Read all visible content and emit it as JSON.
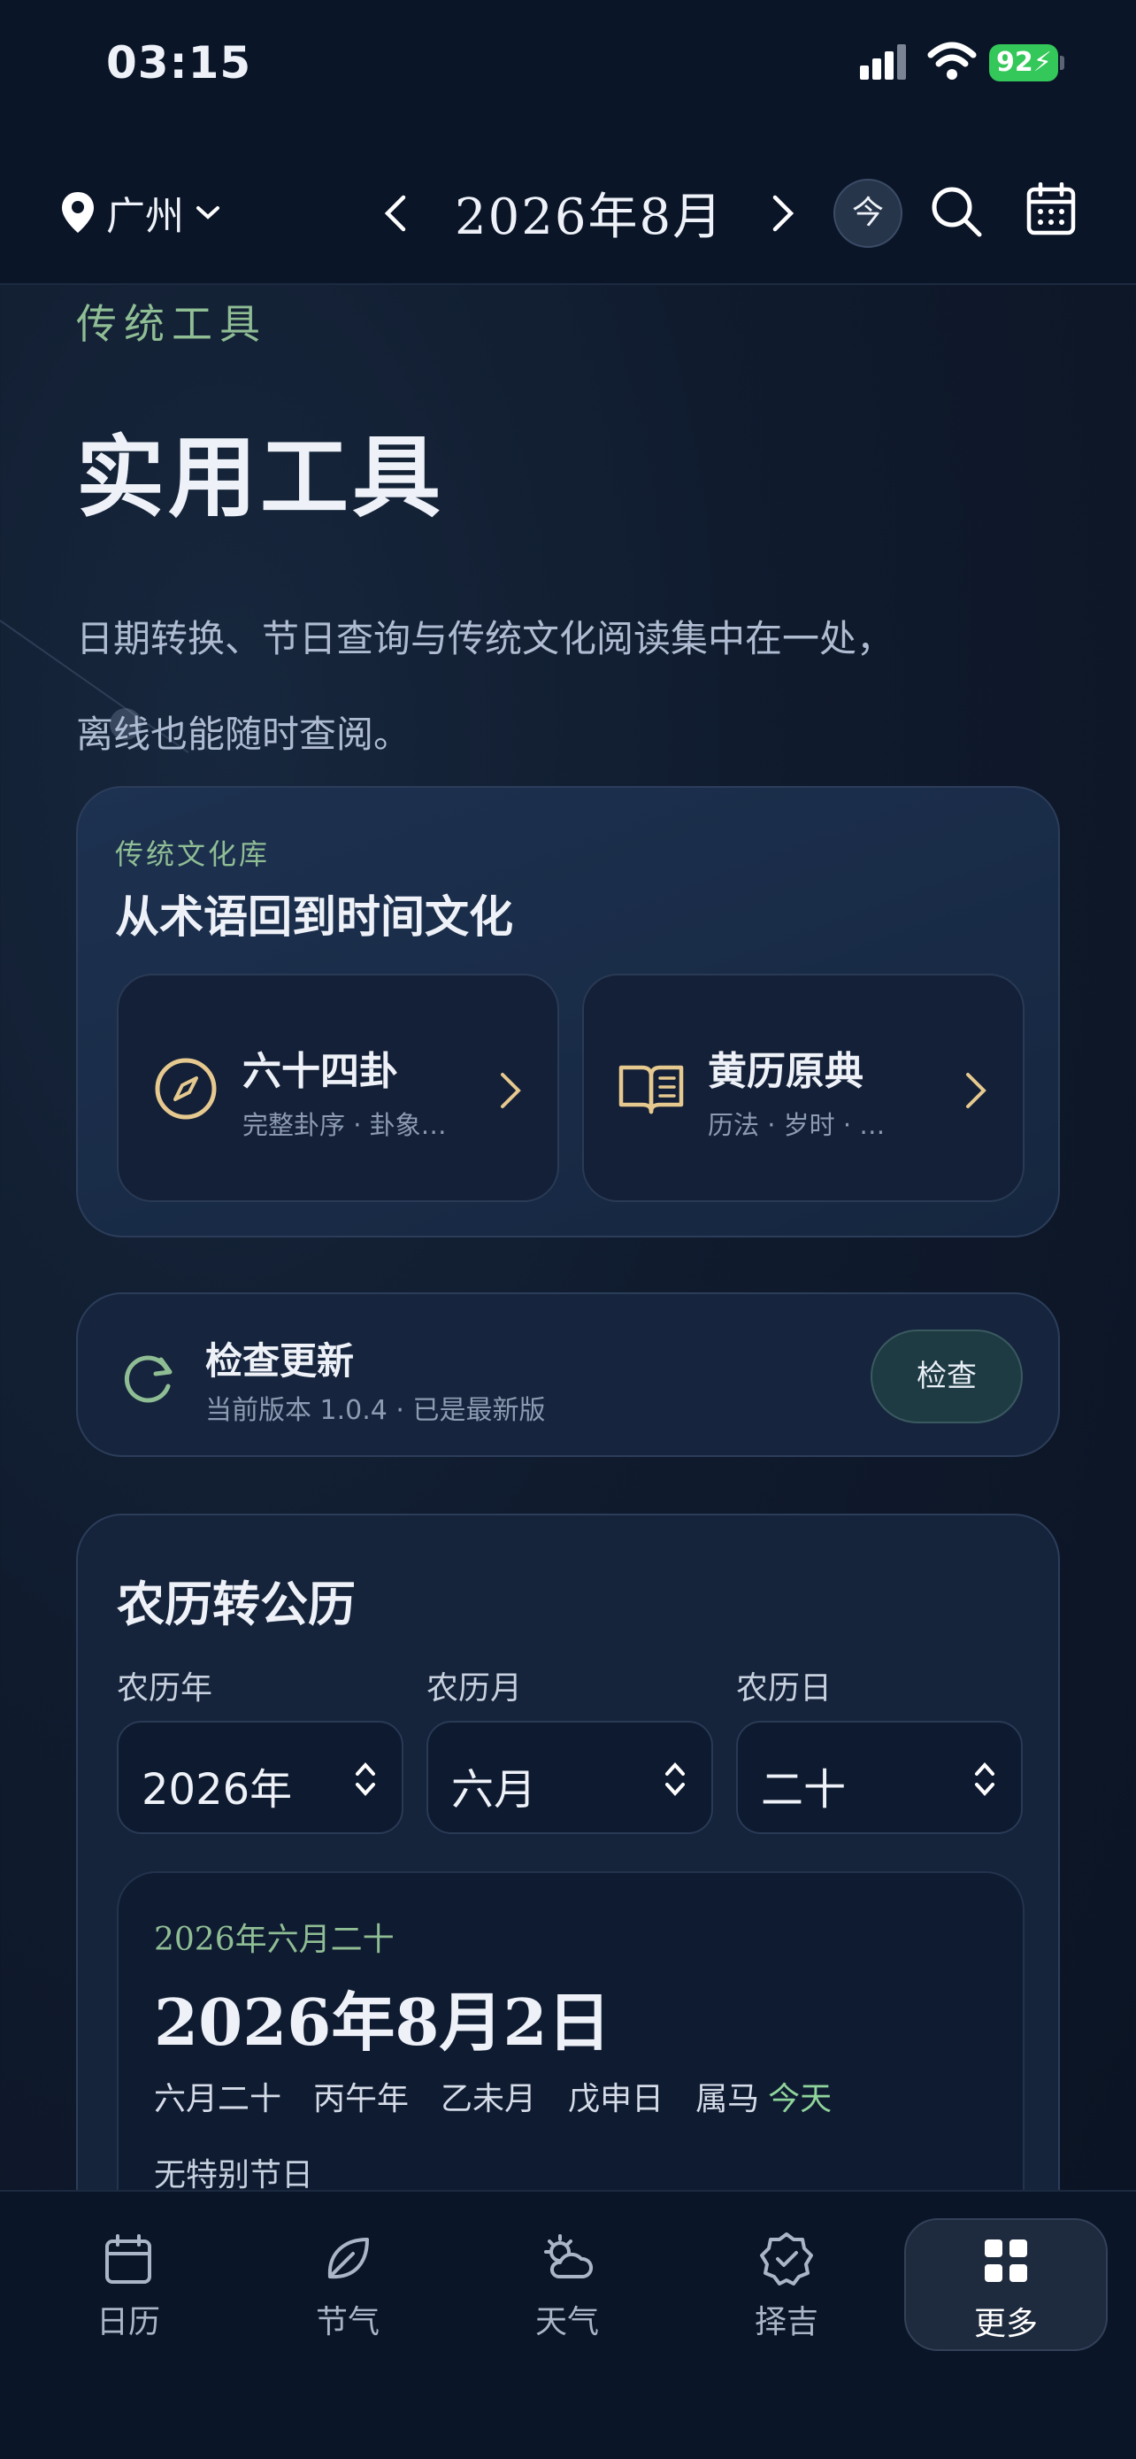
{
  "status_bar": {
    "time": "03:15",
    "battery": "92"
  },
  "header": {
    "city": "广州",
    "month_title": "2026年8月",
    "today_button": "今"
  },
  "page": {
    "eyebrow": "传统工具",
    "title": "实用工具",
    "intro": "日期转换、节日查询与传统文化阅读集中在一处，离线也能随时查阅。"
  },
  "library": {
    "eyebrow": "传统文化库",
    "title": "从术语回到时间文化",
    "tiles": [
      {
        "name": "六十四卦",
        "subtitle": "完整卦序 · 卦象…",
        "icon": "compass-icon"
      },
      {
        "name": "黄历原典",
        "subtitle": "历法 · 岁时 · …",
        "icon": "book-icon"
      }
    ]
  },
  "update": {
    "title": "检查更新",
    "subtitle": "当前版本 1.0.4 · 已是最新版",
    "button": "检查"
  },
  "converter": {
    "title": "农历转公历",
    "fields": [
      {
        "label": "农历年",
        "value": "2026年"
      },
      {
        "label": "农历月",
        "value": "六月"
      },
      {
        "label": "农历日",
        "value": "二十"
      }
    ],
    "result": {
      "lunar": "2026年六月二十",
      "solar": "2026年8月2日",
      "meta": [
        "六月二十",
        "丙午年",
        "乙未月",
        "戊申日",
        "属马"
      ],
      "today_tag": "今天",
      "festival": "无特别节日"
    }
  },
  "tabs": [
    {
      "label": "日历",
      "icon": "calendar-icon",
      "active": false
    },
    {
      "label": "节气",
      "icon": "leaf-icon",
      "active": false
    },
    {
      "label": "天气",
      "icon": "weather-icon",
      "active": false
    },
    {
      "label": "择吉",
      "icon": "badge-check-icon",
      "active": false
    },
    {
      "label": "更多",
      "icon": "grid-icon",
      "active": true
    }
  ],
  "colors": {
    "accent_green": "#8fbd94",
    "battery_green": "#34c759",
    "background": "#101b2e"
  }
}
